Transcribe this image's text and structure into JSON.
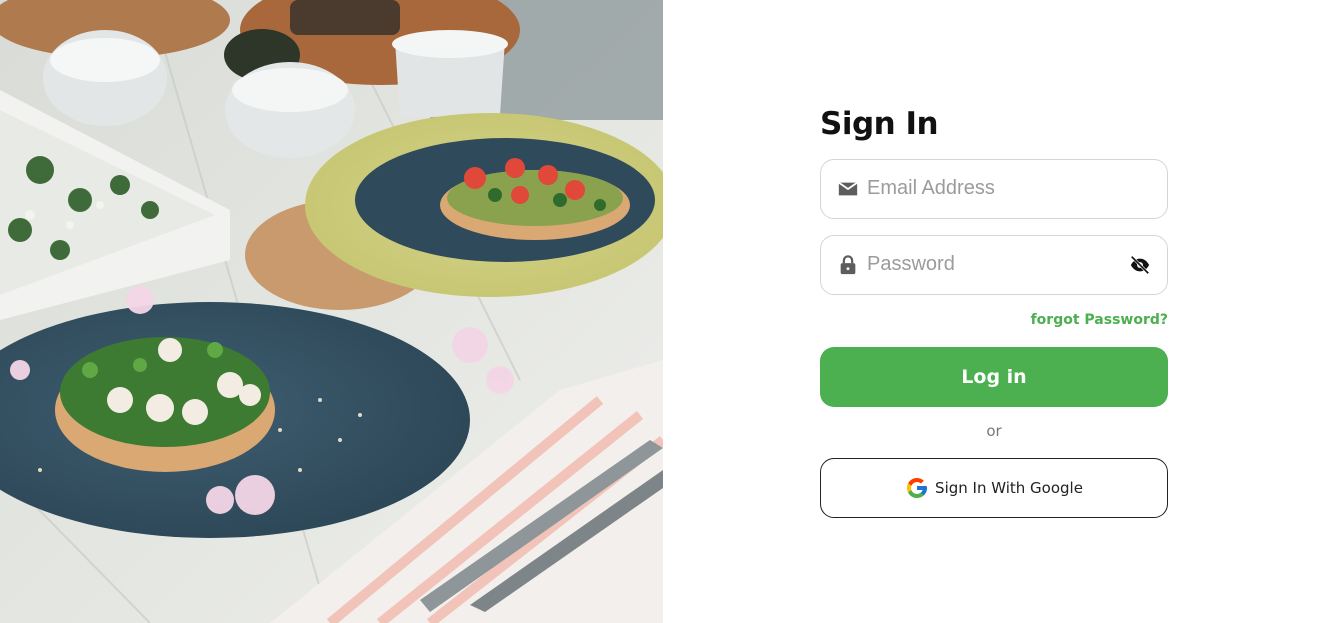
{
  "hero": {
    "image_description_name": "food-plates-photo"
  },
  "form": {
    "title": "Sign In",
    "email": {
      "placeholder": "Email Address",
      "value": "",
      "icon": "mail-icon"
    },
    "password": {
      "placeholder": "Password",
      "value": "",
      "icon": "lock-icon",
      "toggle_icon": "eye-off-icon"
    },
    "forgot_label": "forgot Password?",
    "login_label": "Log in",
    "divider_label": "or",
    "google_label": "Sign In With Google",
    "google_icon": "google-icon"
  },
  "colors": {
    "accent": "#4caf50",
    "border": "#d5d5d5",
    "text": "#111111"
  }
}
